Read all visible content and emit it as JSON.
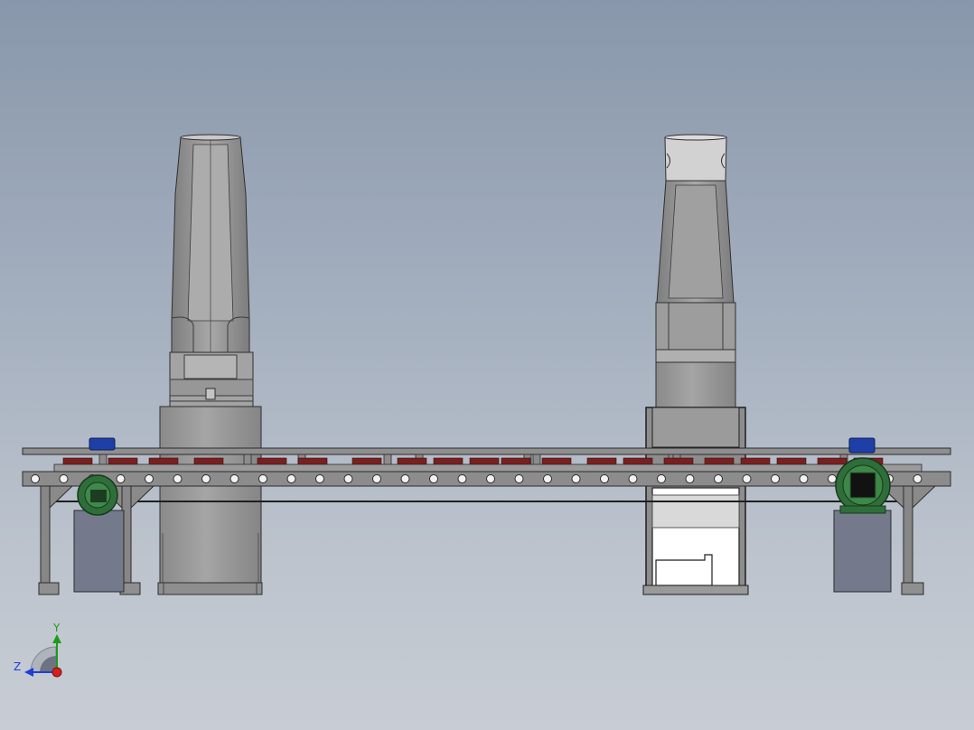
{
  "triad": {
    "y_label": "Y",
    "z_label": "Z",
    "x_color": "#d61f1f",
    "y_color": "#1a9c1a",
    "z_color": "#1f3fd6"
  },
  "colors": {
    "frame": "#868686",
    "frame_edge": "#2b2b2b",
    "pallet": "#7a1f1f",
    "motor_housing": "#2f6e3a",
    "motor_cap": "#1e3fa8",
    "cabinet": "#747a8c",
    "robot_body": "#9a9a9a",
    "robot_shadow": "#7d7d7d"
  }
}
